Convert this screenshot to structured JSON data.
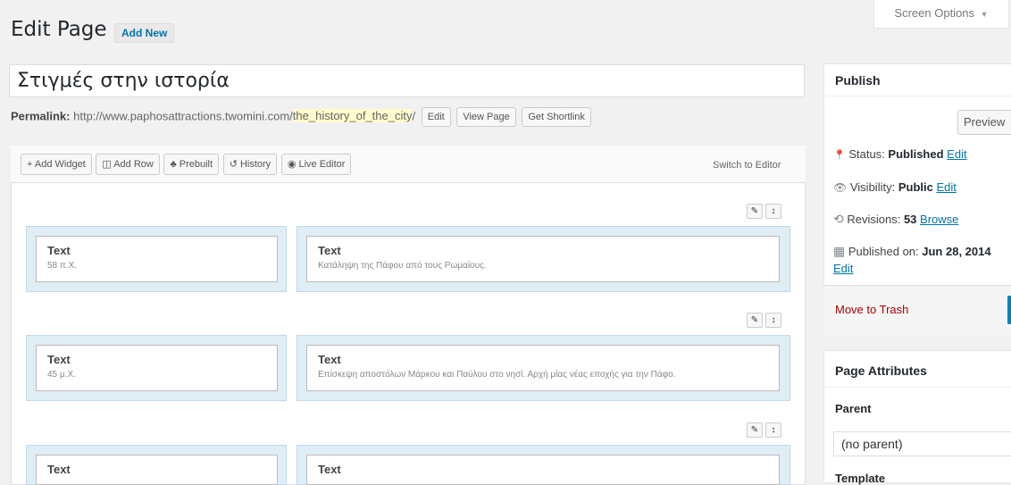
{
  "screen_options": {
    "label": "Screen Options",
    "arrow": "▼"
  },
  "header": {
    "title": "Edit Page",
    "add_new": "Add New"
  },
  "post": {
    "title_value": "Στιγμές στην ιστορία",
    "permalink_label": "Permalink:",
    "permalink_base": "http://www.paphosattractions.twomini.com/",
    "permalink_slug": "the_history_of_the_city",
    "permalink_trail": "/",
    "buttons": {
      "edit": "Edit",
      "view": "View Page",
      "shortlink": "Get Shortlink"
    }
  },
  "builder": {
    "toolbar": {
      "add_widget": "+ Add Widget",
      "add_row": "◫ Add Row",
      "prebuilt": "♣ Prebuilt",
      "history": "↺ History",
      "live_editor": "◉ Live Editor",
      "switch": "Switch to Editor"
    },
    "row_controls": {
      "wrench": "✎",
      "move": "↕"
    },
    "rows": [
      {
        "left": {
          "title": "Text",
          "desc": "58 π.Χ."
        },
        "right": {
          "title": "Text",
          "desc": "Κατάληψη της Πάφου από τους Ρωμαίους."
        }
      },
      {
        "left": {
          "title": "Text",
          "desc": "45 μ.Χ."
        },
        "right": {
          "title": "Text",
          "desc": "Επίσκεψη αποστόλων Μάρκου και Παύλου στο νησί. Αρχή μίας νέας εποχής για την Πάφο."
        }
      },
      {
        "left": {
          "title": "Text",
          "desc": ""
        },
        "right": {
          "title": "Text",
          "desc": ""
        }
      }
    ]
  },
  "publish": {
    "heading": "Publish",
    "preview": "Preview",
    "status_label": "Status:",
    "status_value": "Published",
    "status_edit": "Edit",
    "visibility_label": "Visibility:",
    "visibility_value": "Public",
    "visibility_edit": "Edit",
    "revisions_label": "Revisions:",
    "revisions_value": "53",
    "revisions_browse": "Browse",
    "published_label": "Published on:",
    "published_value": "Jun 28, 2014",
    "published_edit": "Edit",
    "trash": "Move to Trash"
  },
  "page_attributes": {
    "heading": "Page Attributes",
    "parent_label": "Parent",
    "parent_value": "(no parent)",
    "template_label": "Template"
  },
  "icons": {
    "pin": "📍",
    "eye": "👁",
    "history": "⟲",
    "calendar": "▦"
  },
  "colors": {
    "link": "#0073aa",
    "trash": "#a00",
    "cell_bg": "#dfeef5"
  }
}
